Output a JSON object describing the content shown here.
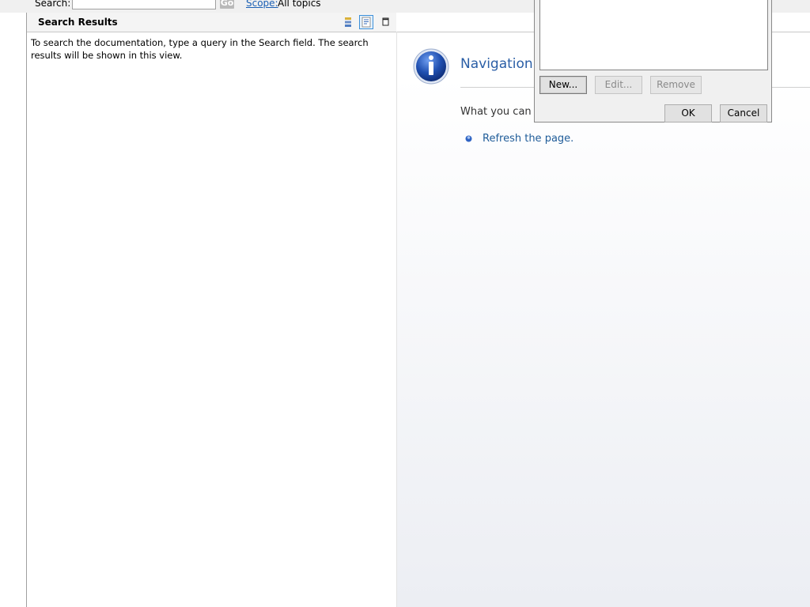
{
  "search": {
    "label": "Search:",
    "value": "",
    "placeholder": "",
    "go_label": "Go",
    "scope_link": "Scope:",
    "scope_value": "All topics"
  },
  "results": {
    "title": "Search Results",
    "message": "To search the documentation, type a query in the Search field. The search results will be shown in this view.",
    "toolbar": [
      "show-categories-icon",
      "show-descriptions-icon",
      "maximize-icon"
    ]
  },
  "content": {
    "heading": "Navigation t",
    "prompt": "What you can t",
    "link": "Refresh the page."
  },
  "dialog": {
    "buttons": {
      "new": "New...",
      "edit": "Edit...",
      "remove": "Remove",
      "ok": "OK",
      "cancel": "Cancel"
    }
  },
  "colors": {
    "link": "#1a5fb4",
    "heading": "#2a5ea6",
    "info_icon": "#1f4fb0"
  }
}
